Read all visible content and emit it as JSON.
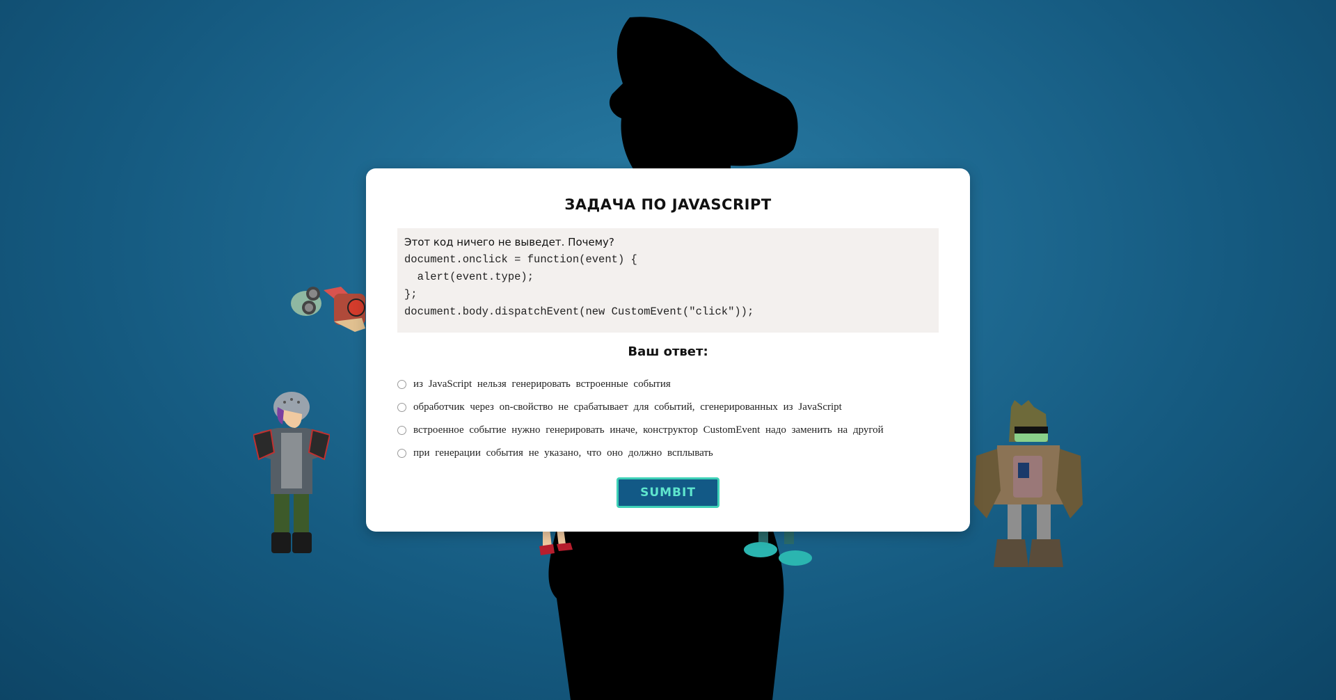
{
  "modal": {
    "title": "ЗАДАЧА ПО JAVASCRIPT",
    "question": "Этот код ничего не выведет. Почему?",
    "code_lines": [
      "document.onclick = function(event) {",
      "  alert(event.type);",
      "};",
      "document.body.dispatchEvent(new CustomEvent(\"click\"));"
    ],
    "answer_label": "Ваш ответ:",
    "options": [
      "из JavaScript нельзя генерировать встроенные события",
      "обработчик через on-свойство не срабатывает для событий, сгенерированных из JavaScript",
      "встроенное событие нужно генерировать иначе, конструктор CustomEvent надо заменить на другой",
      "при генерации события не указано, что оно должно всплывать"
    ],
    "submit_label": "SUMBIT"
  },
  "colors": {
    "background": "#1f6b93",
    "modal_bg": "#ffffff",
    "code_bg": "#f3f0ee",
    "submit_bg": "#125986",
    "submit_border": "#3ed1b7",
    "submit_text": "#5fe6cd"
  }
}
